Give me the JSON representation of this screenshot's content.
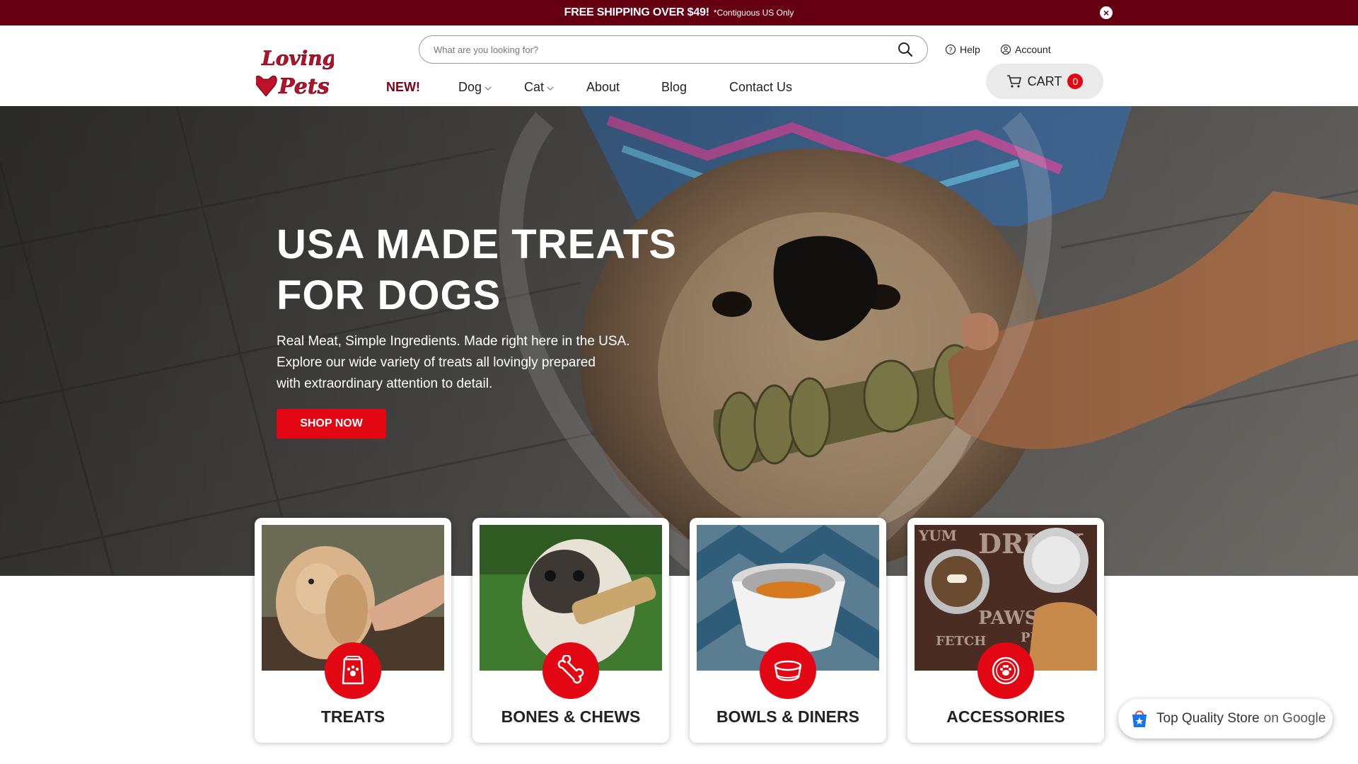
{
  "promo": {
    "headline": "FREE SHIPPING OVER $49!",
    "note": "*Contiguous US Only",
    "close_glyph": "×"
  },
  "brand": {
    "logo_word1": "Loving",
    "logo_word2": "Pets"
  },
  "search": {
    "placeholder": "What are you looking for?"
  },
  "utility": {
    "help": "Help",
    "account": "Account"
  },
  "nav": {
    "items": [
      {
        "label": "NEW!"
      },
      {
        "label": "Dog"
      },
      {
        "label": "Cat"
      },
      {
        "label": "About"
      },
      {
        "label": "Blog"
      },
      {
        "label": "Contact Us"
      }
    ]
  },
  "cart": {
    "label": "CART",
    "count": "0"
  },
  "hero": {
    "title_line1": "USA MADE TREATS",
    "title_line2": "FOR DOGS",
    "sub_line1": "Real Meat, Simple Ingredients. Made right here in the USA.",
    "sub_line2": "Explore our wide variety of treats all lovingly prepared",
    "sub_line3": "with extraordinary attention to detail.",
    "cta": "SHOP NOW"
  },
  "categories": [
    {
      "label": "TREATS",
      "icon": "treat-bag-icon"
    },
    {
      "label": "BONES & CHEWS",
      "icon": "bone-icon"
    },
    {
      "label": "BOWLS & DINERS",
      "icon": "bowl-icon"
    },
    {
      "label": "ACCESSORIES",
      "icon": "paw-badge-icon"
    }
  ],
  "google_badge": {
    "text": "Top Quality Store",
    "suffix": "on Google"
  },
  "colors": {
    "promo_bg": "#650012",
    "accent_red": "#e30613",
    "new_red": "#7a0014"
  }
}
